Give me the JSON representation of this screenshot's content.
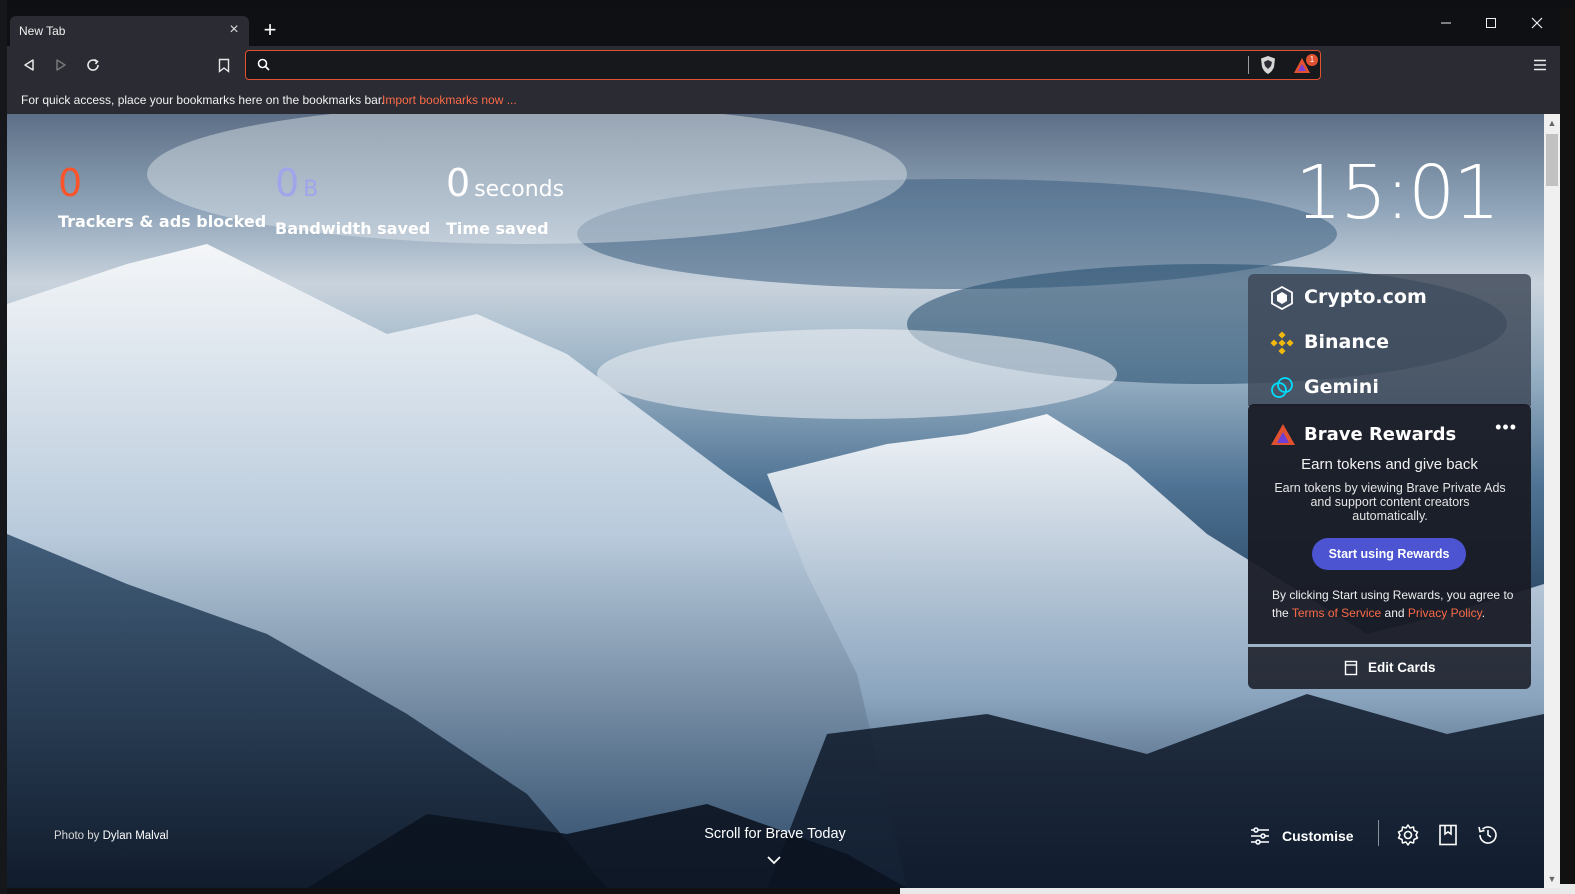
{
  "tab": {
    "title": "New Tab",
    "close": "×",
    "new": "+"
  },
  "window": {
    "minimize": "—",
    "maximize": "☐",
    "close": "✕"
  },
  "omnibox": {
    "value": "",
    "placeholder": "",
    "rewards_badge": "1"
  },
  "bookmarks_bar": {
    "text": "For quick access, place your bookmarks here on the bookmarks bar.",
    "link": "Import bookmarks now ..."
  },
  "stats": [
    {
      "value": "0",
      "unit": "",
      "label": "Trackers & ads blocked",
      "color": "#fb542b"
    },
    {
      "value": "0",
      "unit": "B",
      "label": "Bandwidth saved",
      "color": "#a0a5eb"
    },
    {
      "value": "0",
      "unit": "seconds",
      "label": "Time saved",
      "color": "#ffffff"
    }
  ],
  "clock": "15:01",
  "cards": {
    "crypto": "Crypto.com",
    "binance": "Binance",
    "gemini": "Gemini",
    "rewards": {
      "title": "Brave Rewards",
      "more": "•••",
      "heading": "Earn tokens and give back",
      "body": "Earn tokens by viewing Brave Private Ads and support content creators automatically.",
      "button": "Start using Rewards",
      "foot_prefix": "By clicking Start using Rewards, you agree to the",
      "terms": "Terms of Service",
      "and": "and",
      "privacy": "Privacy Policy",
      "period": "."
    },
    "edit": "Edit Cards"
  },
  "photo_credit": {
    "prefix": "Photo by",
    "author": "Dylan Malval"
  },
  "scroll_prompt": "Scroll for Brave Today",
  "customise": "Customise",
  "colors": {
    "accent": "#fb542b",
    "button": "#4c54d2",
    "toolbar": "#2a2b33"
  }
}
